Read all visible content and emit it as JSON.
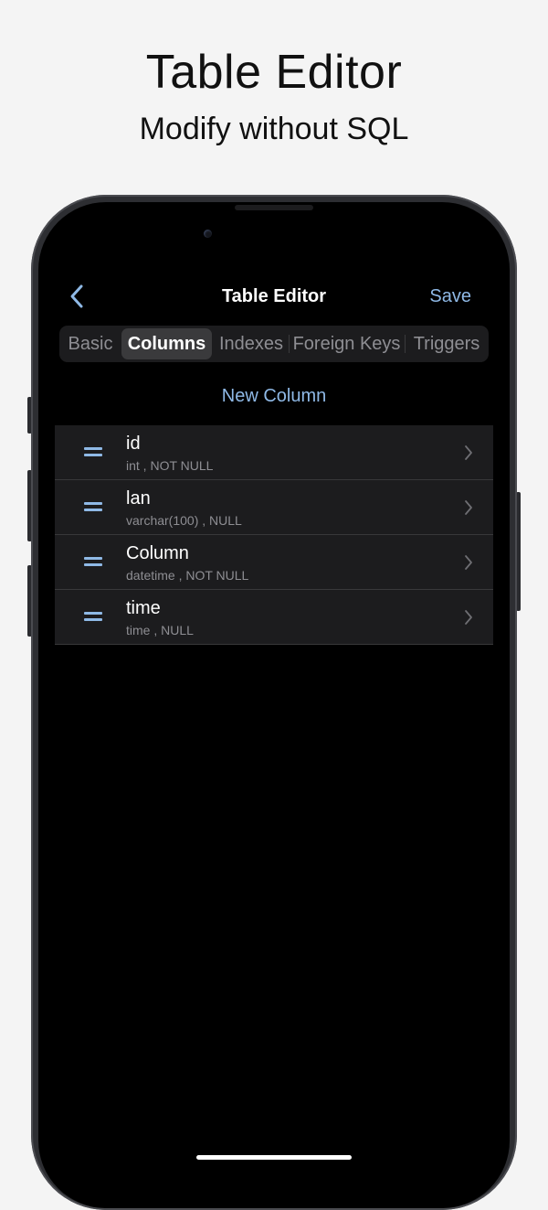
{
  "promo": {
    "title": "Table Editor",
    "subtitle": "Modify without SQL"
  },
  "nav": {
    "back_icon": "chevron-left-icon",
    "title": "Table Editor",
    "save_label": "Save"
  },
  "tabs": [
    {
      "label": "Basic",
      "selected": false
    },
    {
      "label": "Columns",
      "selected": true
    },
    {
      "label": "Indexes",
      "selected": false
    },
    {
      "label": "Foreign Keys",
      "selected": false
    },
    {
      "label": "Triggers",
      "selected": false
    }
  ],
  "new_column_label": "New Column",
  "columns": [
    {
      "name": "id",
      "detail": "int , NOT NULL"
    },
    {
      "name": "lan",
      "detail": "varchar(100) , NULL"
    },
    {
      "name": "Column",
      "detail": "datetime , NOT NULL"
    },
    {
      "name": "time",
      "detail": "time , NULL"
    }
  ],
  "colors": {
    "accent": "#8fb9e6",
    "screen_bg": "#000000",
    "row_bg": "#1c1c1e",
    "secondary_text": "#8e8e93",
    "page_bg": "#f4f4f4"
  }
}
